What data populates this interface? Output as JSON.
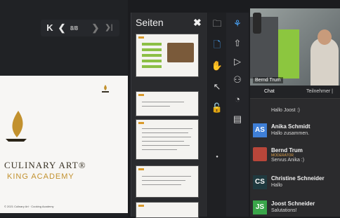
{
  "stage": {
    "pager": "8/8",
    "slide_title": "CULINARY ART®",
    "slide_subtitle": "KING ACADEMY",
    "slide_footer": "© 2021 Culinary Art · Cooking Academy"
  },
  "pages_panel": {
    "title": "Seiten",
    "close": "✖"
  },
  "video": {
    "participant_name": "Bernd Trum"
  },
  "tabs": {
    "chat": "Chat",
    "participants": "Teilnehmer |"
  },
  "chat": {
    "first_text": "Hallo Joost :)",
    "messages": [
      {
        "initials": "AS",
        "name": "Anika Schmidt",
        "text": "Hallo zusammen.",
        "color": "#3f7fd6"
      },
      {
        "initials": "",
        "name": "Bernd Trum",
        "time": "MODERATOR",
        "text": "Servus Anika :)",
        "color": "#c0392b"
      },
      {
        "initials": "CS",
        "name": "Christine Schneider",
        "text": "Hallo",
        "color": "#1f3a3f"
      },
      {
        "initials": "JS",
        "name": "Joost Schneider",
        "text": "Salutations!",
        "color": "#3aa64a"
      }
    ]
  },
  "colors": {
    "accent_blue": "#4aa8ff",
    "brand_gold": "#c2912e"
  }
}
